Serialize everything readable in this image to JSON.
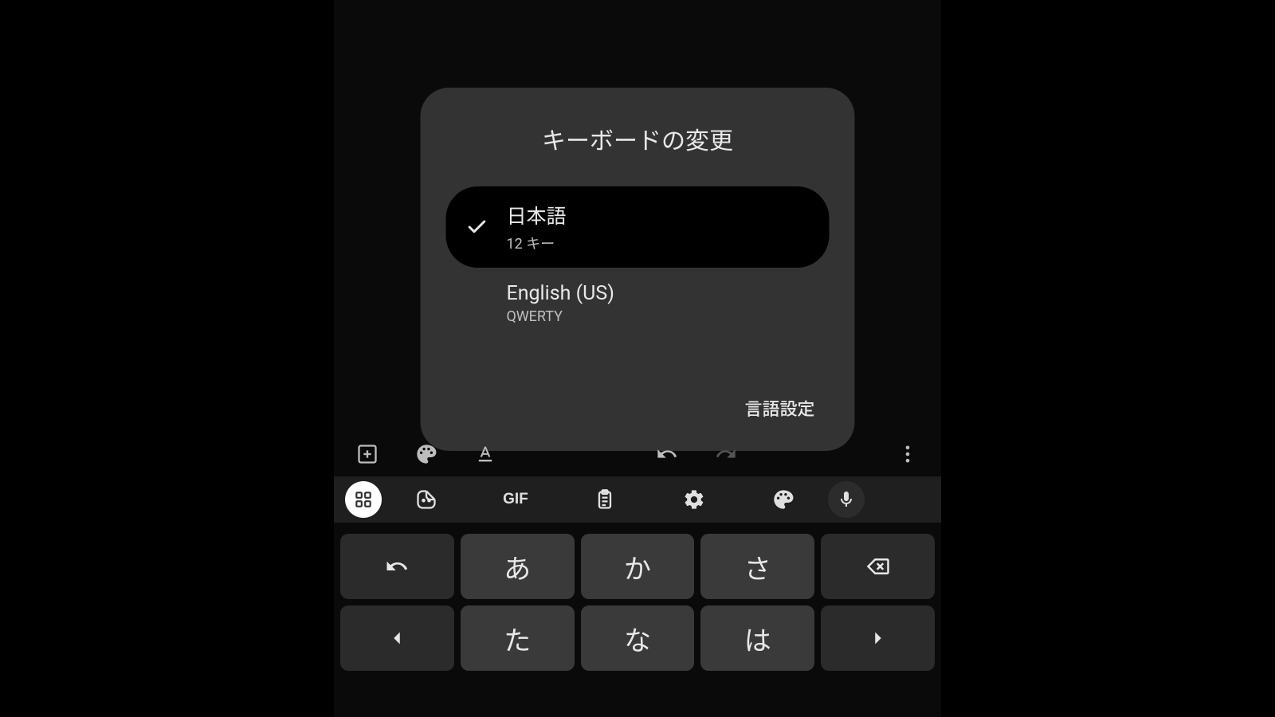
{
  "dialog": {
    "title": "キーボードの変更",
    "options": [
      {
        "title": "日本語",
        "subtitle": "12 キー",
        "selected": true
      },
      {
        "title": "English (US)",
        "subtitle": "QWERTY",
        "selected": false
      }
    ],
    "settings_label": "言語設定"
  },
  "text_toolbar": {
    "add": "add-icon",
    "palette": "palette-icon",
    "format": "text-format-icon",
    "undo": "undo-icon",
    "redo": "redo-icon",
    "redo_disabled": true,
    "more": "more-vert-icon"
  },
  "kbd_tools": {
    "apps": "apps-icon",
    "sticker": "sticker-icon",
    "gif_label": "GIF",
    "clipboard": "clipboard-icon",
    "settings": "gear-icon",
    "theme": "palette-icon",
    "mic": "mic-icon"
  },
  "keys": {
    "row1": {
      "back": "undo-icon",
      "k1": "あ",
      "k2": "か",
      "k3": "さ",
      "backspace": "backspace-icon"
    },
    "row2": {
      "left": "cursor-left-icon",
      "k1": "た",
      "k2": "な",
      "k3": "は",
      "right": "cursor-right-icon"
    }
  }
}
